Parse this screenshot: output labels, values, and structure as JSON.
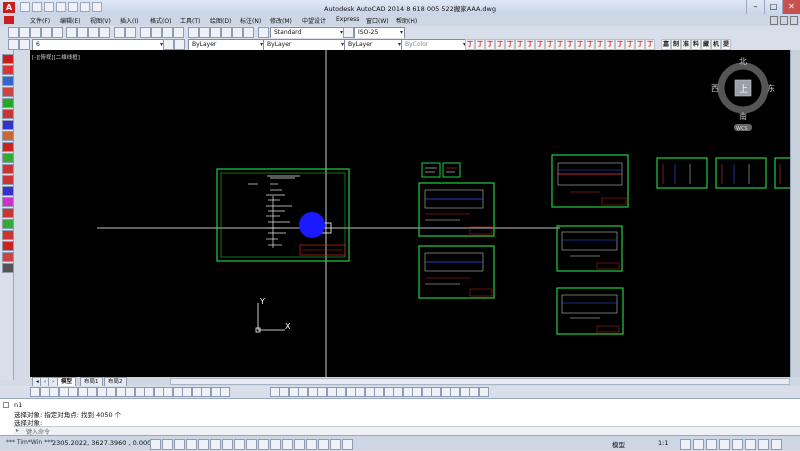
{
  "title_bar": {
    "app_icon": "A",
    "title": "Autodesk AutoCAD 2014    8 618 005 522搬家AAA.dwg"
  },
  "menu": [
    "文件(F)",
    "编辑(E)",
    "视图(V)",
    "插入(I)",
    "格式(O)",
    "工具(T)",
    "绘图(D)",
    "标注(N)",
    "修改(M)",
    "中望设计",
    "Express",
    "窗口(W)",
    "帮助(H)"
  ],
  "toolbar": {
    "text_style": "Standard",
    "dim_style": "ISO-25",
    "layer": "6",
    "color": "ByLayer",
    "linetype": "ByLayer",
    "lineweight": "ByLayer",
    "plot_style": "ByColor",
    "red_buttons": [
      "丁",
      "丁",
      "丁",
      "丁",
      "丁",
      "丁",
      "丁",
      "丁",
      "丁",
      "丁",
      "丁",
      "丁",
      "丁",
      "丁",
      "丁",
      "丁",
      "丁",
      "丁",
      "丁"
    ],
    "chinese_buttons": [
      "嘉",
      "制",
      "准",
      "料",
      "藏",
      "机",
      "提"
    ]
  },
  "canvas": {
    "viewport_label": "[-][俯视][二维线框]",
    "sheet_title": "设计图纸目录及说明",
    "ucs_x": "X",
    "ucs_y": "Y"
  },
  "viewcube": {
    "north": "北",
    "south": "南",
    "east": "东",
    "west": "西",
    "top": "上",
    "wcs": "WCS"
  },
  "tabs": [
    "模型",
    "布局1",
    "布局2"
  ],
  "command": {
    "line1": "n1",
    "line2": "选择对象: 指定对角点: 找到 4050 个",
    "line3": "选择对象:",
    "prompt": "键入命令"
  },
  "status": {
    "coords": "2305.2022, 3627.3960 , 0.0000",
    "model_label": "模型",
    "scale": "1:1"
  },
  "colors": {
    "canvas": "#000000",
    "border_green": "#22cc44",
    "accent_red": "#c81e1e",
    "highlight_blue": "#1a1aff"
  }
}
